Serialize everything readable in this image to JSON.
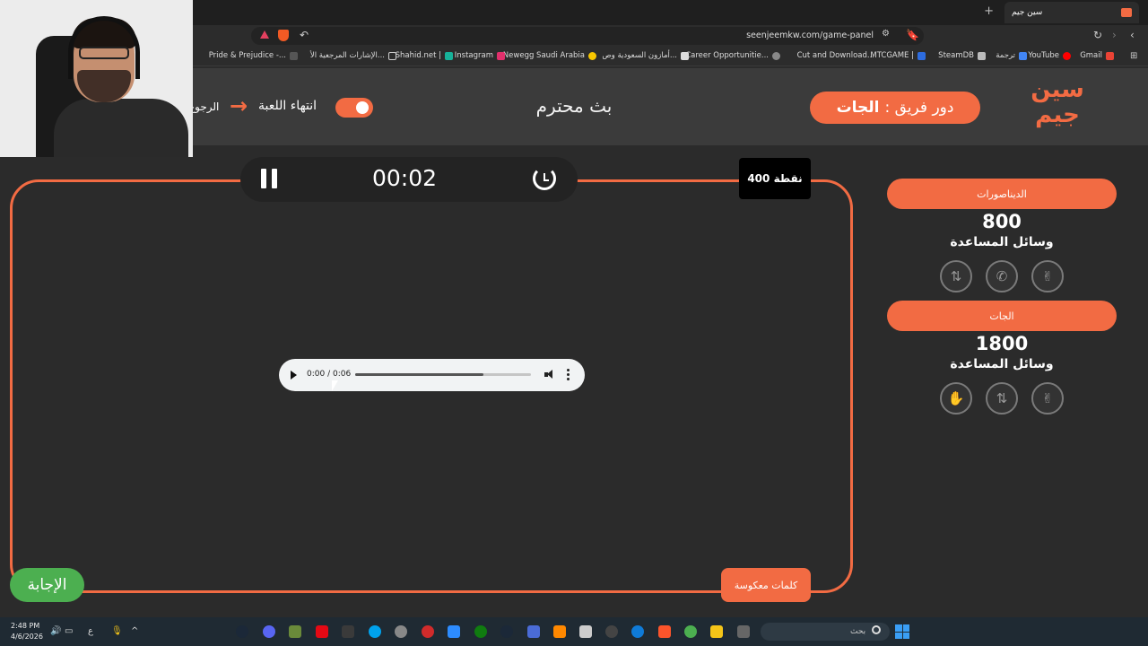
{
  "browser": {
    "tab_title": "سين جيم",
    "tab_close": "×",
    "new_tab": "+",
    "url": "seenjeemkw.com/game-panel",
    "bookmarks": [
      "Gmail",
      "YouTube",
      "ترجمة",
      "SteamDB",
      "MTCGAME |",
      "Cut and Download...",
      "Career Opportunitie...",
      "أمازون السعودية وص...",
      "Newegg Saudi Arabia",
      "Instagram",
      "Shahid.net |",
      "الإشارات المرجعية الأ...",
      "Pride & Prejudice -..."
    ]
  },
  "header": {
    "logo_text": "سين جيم",
    "turn_label": "دور فريق :",
    "turn_team": "الجات",
    "broadcast": "بث محترم",
    "end_game": "انتهاء اللعبة",
    "back": "الرجوع"
  },
  "game": {
    "timer": "00:02",
    "points": "400 نقطة",
    "category": "كلمات معكوسة",
    "answer_button": "الإجابة",
    "audio": {
      "time": "0:00 / 0:06",
      "progress": 0.73
    }
  },
  "teams": [
    {
      "name": "الديناصورات",
      "score": "800",
      "helps_label": "وسائل المساعدة",
      "helps": [
        "swap-icon",
        "phone-icon",
        "peace-hand-icon"
      ]
    },
    {
      "name": "الجات",
      "score": "1800",
      "helps_label": "وسائل المساعدة",
      "helps": [
        "stop-hand-icon",
        "swap-icon",
        "peace-hand-icon"
      ]
    }
  ],
  "taskbar": {
    "time": "2:48 PM",
    "date": "4/6/2026",
    "lang": "ع",
    "search_placeholder": "بحث"
  },
  "colors": {
    "accent": "#f26b43",
    "answer": "#4caf50",
    "background": "#2b2b2b"
  }
}
